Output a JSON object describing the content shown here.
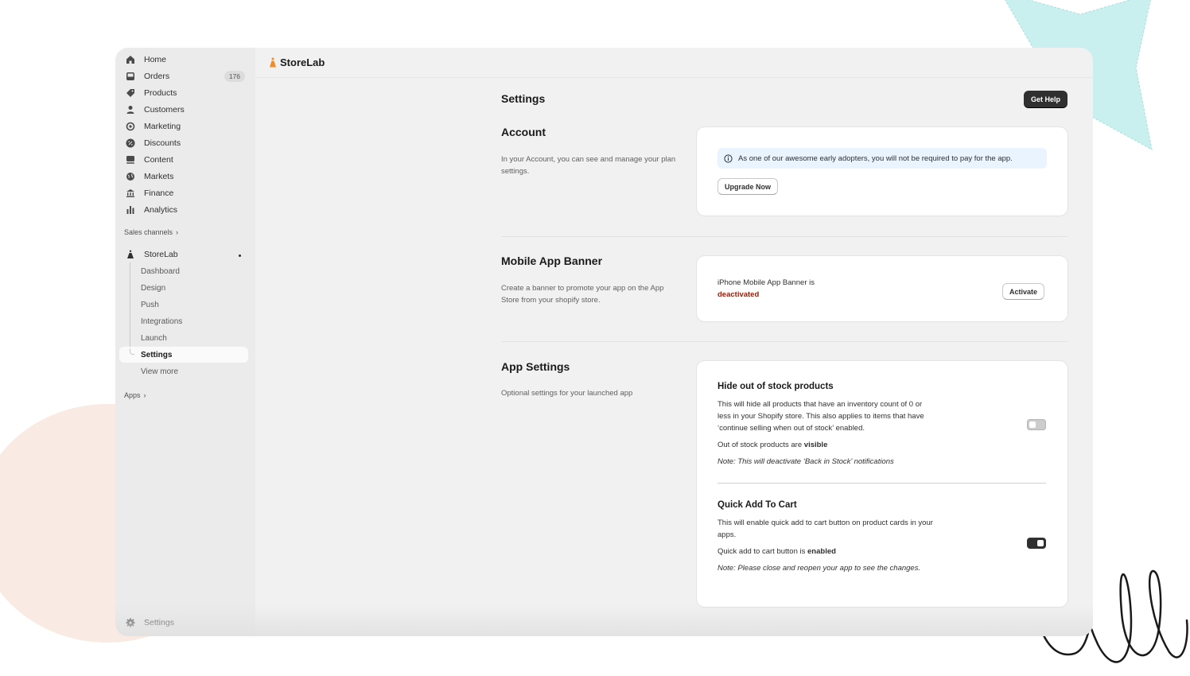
{
  "colors": {
    "accent": "#303030",
    "status_deactivated": "#8e1f0b",
    "info_banner": "#eaf4ff",
    "brand_icon": "#f28c28"
  },
  "sidebar": {
    "items": [
      {
        "label": "Home",
        "icon": "home-icon"
      },
      {
        "label": "Orders",
        "icon": "orders-icon",
        "badge": "176"
      },
      {
        "label": "Products",
        "icon": "tag-icon"
      },
      {
        "label": "Customers",
        "icon": "person-icon"
      },
      {
        "label": "Marketing",
        "icon": "target-icon"
      },
      {
        "label": "Discounts",
        "icon": "discount-icon"
      },
      {
        "label": "Content",
        "icon": "content-icon"
      },
      {
        "label": "Markets",
        "icon": "globe-icon"
      },
      {
        "label": "Finance",
        "icon": "bank-icon"
      },
      {
        "label": "Analytics",
        "icon": "bar-chart-icon"
      }
    ],
    "sales_channels": "Sales channels",
    "app": {
      "label": "StoreLab",
      "icon": "storelab-icon",
      "subitems": [
        "Dashboard",
        "Design",
        "Push",
        "Integrations",
        "Launch",
        "Settings",
        "View more"
      ],
      "active": "Settings"
    },
    "apps": "Apps",
    "settings": {
      "label": "Settings",
      "icon": "gear-icon"
    }
  },
  "topbar": {
    "brand": "StoreLab"
  },
  "page": {
    "title": "Settings",
    "help_button": "Get Help"
  },
  "sections": {
    "account": {
      "title": "Account",
      "description": "In your Account, you can see and manage your plan settings.",
      "banner": "As one of our awesome early adopters, you will not be required to pay for the app.",
      "button": "Upgrade Now"
    },
    "banner": {
      "title": "Mobile App Banner",
      "description": "Create a banner to promote your app on the App Store from your shopify store.",
      "status_prefix": "iPhone Mobile App Banner is",
      "status": "deactivated",
      "button": "Activate"
    },
    "app_settings": {
      "title": "App Settings",
      "description": "Optional settings for your launched app",
      "hide_stock": {
        "title": "Hide out of stock products",
        "description": "This will hide all products that have an inventory count of 0 or less in your Shopify store. This also applies to items that have ‘continue selling when out of stock’ enabled.",
        "status_prefix": "Out of stock products are",
        "status": "visible",
        "note": "Note: This will deactivate ‘Back in Stock’ notifications",
        "enabled": false
      },
      "quick_add": {
        "title": "Quick Add To Cart",
        "description": "This will enable quick add to cart button on product cards in your apps.",
        "status_prefix": "Quick add to cart button is",
        "status": "enabled",
        "note": "Note: Please close and reopen your app to see the changes.",
        "enabled": true
      }
    }
  }
}
